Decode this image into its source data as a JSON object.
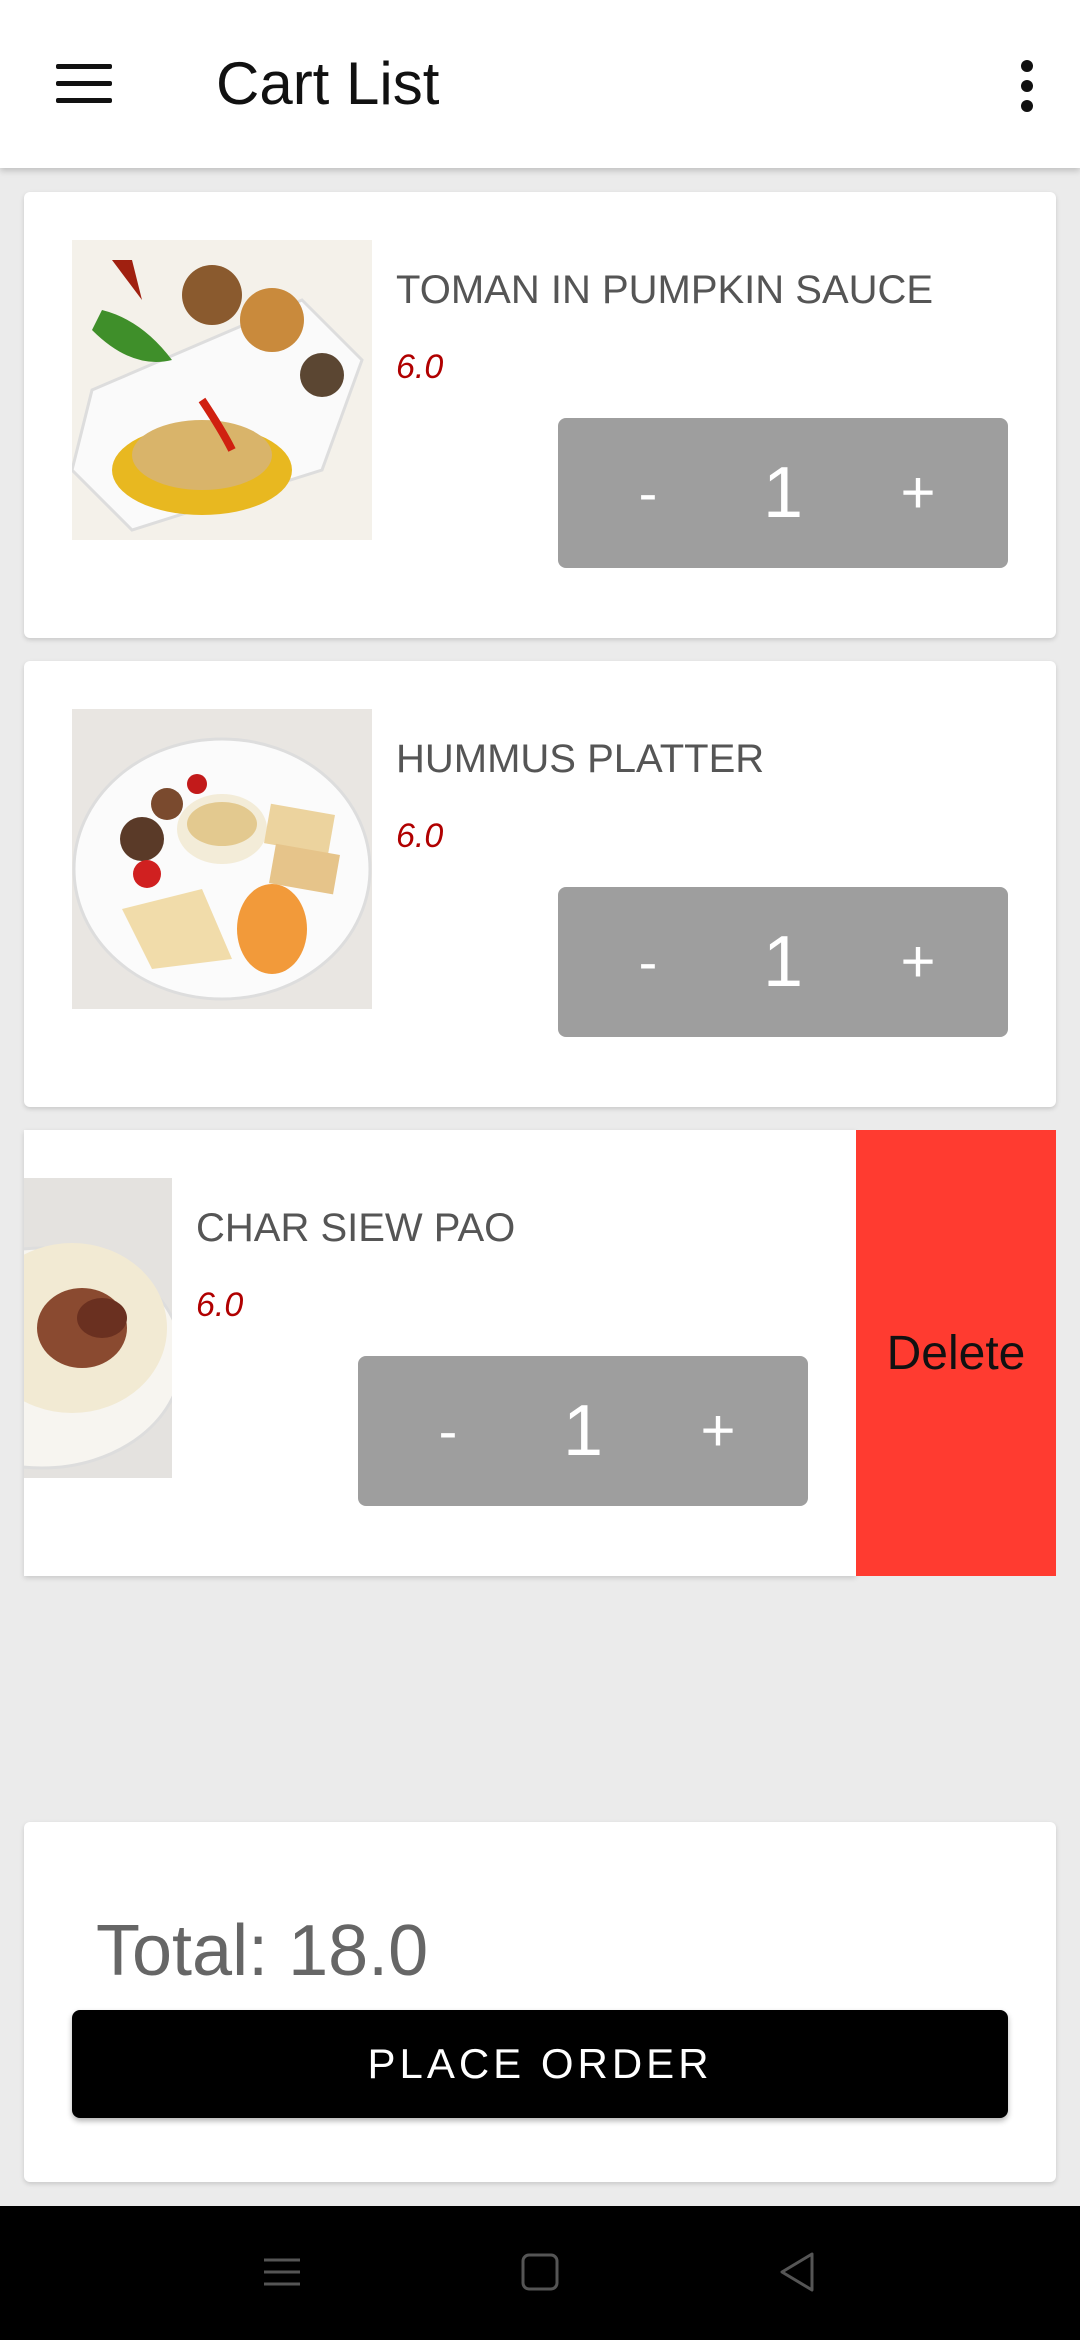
{
  "app_bar": {
    "title": "Cart List"
  },
  "items": [
    {
      "name": "TOMAN IN PUMPKIN SAUCE",
      "price": "6.0",
      "qty": "1",
      "minus": "-",
      "plus": "+"
    },
    {
      "name": "HUMMUS PLATTER",
      "price": "6.0",
      "qty": "1",
      "minus": "-",
      "plus": "+"
    },
    {
      "name": "CHAR SIEW PAO",
      "price": "6.0",
      "qty": "1",
      "minus": "-",
      "plus": "+"
    }
  ],
  "swipe_action": {
    "label": "Delete",
    "color": "#ff3b30"
  },
  "summary": {
    "total": "Total: 18.0",
    "place_order": "PLACE ORDER"
  },
  "system_nav": {
    "icons": [
      "menu-icon",
      "home-icon",
      "back-icon"
    ]
  },
  "colors": {
    "stepper": "#9e9e9e",
    "price": "#b00000",
    "button": "#000000",
    "background": "#ebebeb"
  }
}
